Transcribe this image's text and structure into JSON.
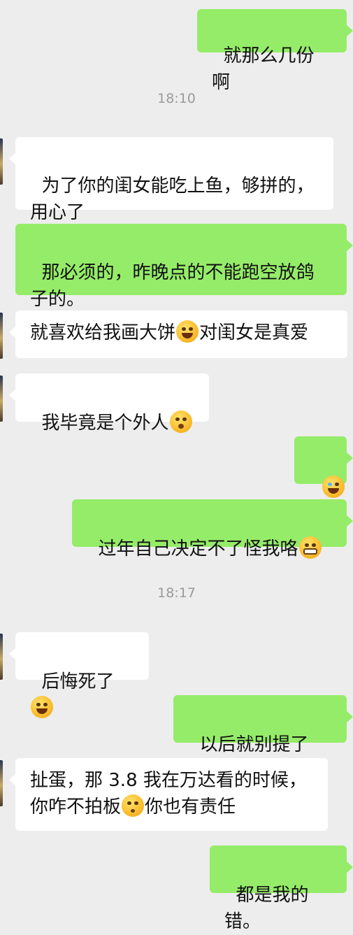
{
  "chat": {
    "messages": [
      {
        "type": "out",
        "text": "就那么几份啊"
      },
      {
        "type": "time",
        "text": "18:10"
      },
      {
        "type": "in",
        "text": "为了你的闺女能吃上鱼，够拼的，用心了"
      },
      {
        "type": "out",
        "text": "那必须的，昨晚点的不能跑空放鸽子的。"
      },
      {
        "type": "in",
        "parts": [
          "就喜欢给我画大饼",
          "对闺女是真爱"
        ],
        "emoji": "grinning-squint-icon"
      },
      {
        "type": "in",
        "parts": [
          "我毕竟是个外人"
        ],
        "emoji": "flushed-face-icon"
      },
      {
        "type": "out",
        "parts": [
          ""
        ],
        "emoji": "rolling-laughing-icon"
      },
      {
        "type": "out",
        "parts": [
          "过年自己决定不了怪我咯"
        ],
        "emoji": "grimacing-grin-icon"
      },
      {
        "type": "time",
        "text": "18:17"
      },
      {
        "type": "in",
        "parts": [
          "后悔死了"
        ],
        "emoji": "grinning-squint-icon"
      },
      {
        "type": "out",
        "parts": [
          "以后就别提了"
        ],
        "emoji": "rolling-laughing-icon"
      },
      {
        "type": "in",
        "parts": [
          "扯蛋，那 3.8 我在万达看的时候，",
          "你咋不拍板",
          "你也有责任"
        ],
        "emoji": "hushed-face-icon"
      },
      {
        "type": "out",
        "text": "都是我的错。"
      }
    ]
  },
  "colors": {
    "background": "#ededed",
    "incoming_bubble": "#ffffff",
    "outgoing_bubble": "#95ec69",
    "timestamp_text": "#9a9a9a"
  }
}
